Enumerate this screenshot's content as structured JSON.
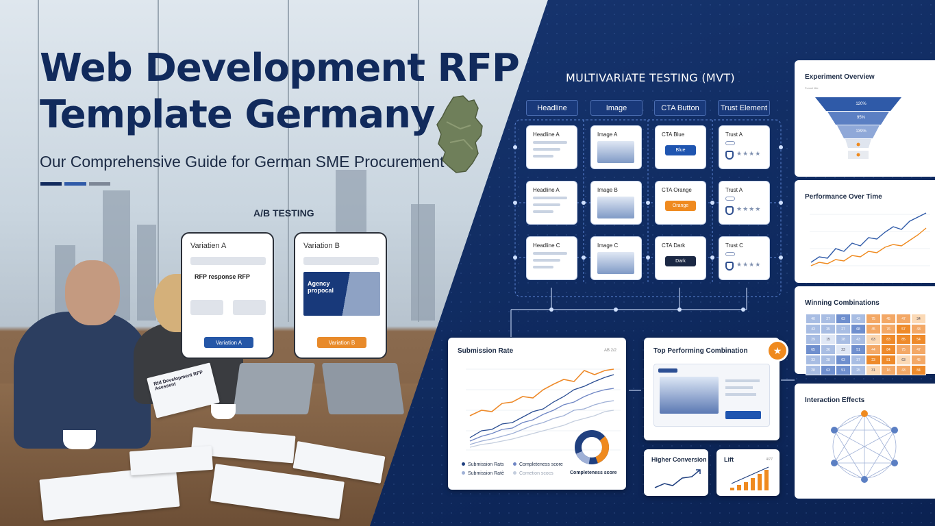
{
  "hero": {
    "title_line1": "Web Development RFP",
    "title_line2": "Template Germany",
    "subtitle": "Our Comprehensive Guide for German SME Procurement",
    "rule_colors": [
      "#112a5c",
      "#2f5aa8",
      "#7d8796"
    ]
  },
  "ab_testing": {
    "heading": "A/B TESTING",
    "variation_a": {
      "label": "Variatien A",
      "headline": "RFP response RFP",
      "button": "Variation A",
      "button_color": "#2557a7"
    },
    "variation_b": {
      "label": "Variation B",
      "banner_text": "Agency propocal",
      "button": "Variation B",
      "button_color": "#e88a2a"
    },
    "document_title": "Rfd Development RFP Acessent"
  },
  "mvt": {
    "heading": "MULTIVARIATE TESTING (MVT)",
    "columns": [
      "Headline",
      "Image",
      "CTA Button",
      "Trust Element"
    ],
    "rows": [
      {
        "headline": "Headline A",
        "image": "Image A",
        "cta": "CTA Blue",
        "cta_button": "Blue",
        "cta_color": "#1f55b0",
        "trust": "Trust A"
      },
      {
        "headline": "Headline A",
        "image": "Image B",
        "cta": "CTA Orange",
        "cta_button": "Orange",
        "cta_color": "#ef8a1f",
        "trust": "Trust A"
      },
      {
        "headline": "Headline C",
        "image": "Image C",
        "cta": "CTA Dark",
        "cta_button": "Dark",
        "cta_color": "#1b2844",
        "trust": "Trust C"
      }
    ],
    "stars": "★★★★"
  },
  "submission": {
    "title": "Submission Rate",
    "corner": "AB 2/2",
    "legend": [
      {
        "label": "Submission Rats",
        "color": "#1f3f7f"
      },
      {
        "label": "Completeness score",
        "color": "#6f86c4"
      },
      {
        "label": "Submission Ratè",
        "color": "#9fb0d6"
      },
      {
        "label": "Cometion scocs",
        "color": "#c4cede"
      }
    ],
    "donut_label": "Completeness score"
  },
  "top_combination": {
    "title": "Top Performing Combination",
    "badge_icon": "star-icon"
  },
  "higher_conversion": {
    "title": "Higher Conversion"
  },
  "lift": {
    "title": "Lift",
    "corner": "4/77"
  },
  "right_panel": {
    "experiment_overview": {
      "title": "Experiment Overview",
      "subtitle": "Funnel title",
      "funnel": [
        "120%",
        "95%",
        "139%"
      ]
    },
    "performance": {
      "title": "Performance Over Time"
    },
    "winning": {
      "title": "Winning Combinations",
      "grid": [
        [
          "40",
          "27",
          "63",
          "43",
          "75",
          "45",
          "47",
          "34"
        ],
        [
          "43",
          "35",
          "27",
          "68",
          "45",
          "76",
          "57",
          "43"
        ],
        [
          "29",
          "15",
          "28",
          "43",
          "63",
          "83",
          "85",
          "54"
        ],
        [
          "65",
          "26",
          "23",
          "51",
          "44",
          "84",
          "75",
          "47"
        ],
        [
          "33",
          "28",
          "63",
          "37",
          "23",
          "81",
          "63",
          "45"
        ],
        [
          "28",
          "63",
          "51",
          "25",
          "31",
          "16",
          "43",
          "84"
        ]
      ]
    },
    "interaction": {
      "title": "Interaction Effects"
    }
  }
}
